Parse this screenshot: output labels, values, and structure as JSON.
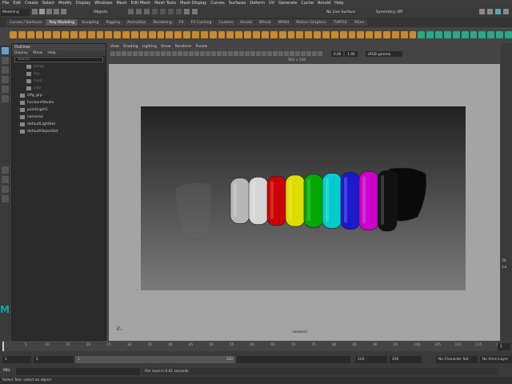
{
  "menubar": [
    "File",
    "Edit",
    "Create",
    "Select",
    "Modify",
    "Display",
    "Windows",
    "Mesh",
    "Edit Mesh",
    "Mesh Tools",
    "Mesh Display",
    "Curves",
    "Surfaces",
    "Deform",
    "UV",
    "Generate",
    "Cache",
    "Arnold",
    "Help"
  ],
  "status": {
    "mode": "Modeling",
    "select_mode": "Objects",
    "live_surface": "No Live Surface",
    "symmetry": "Symmetry: Off"
  },
  "shelf_tabs": [
    "Curves / Surfaces",
    "Poly Modeling",
    "Sculpting",
    "Rigging",
    "Animation",
    "Rendering",
    "FX",
    "FX Caching",
    "Custom",
    "Arnold",
    "Bifrost",
    "MASH",
    "Motion Graphics",
    "TURTLE",
    "XGen"
  ],
  "outliner": {
    "title": "Outliner",
    "menu": [
      "Display",
      "Show",
      "Help"
    ],
    "search_placeholder": "Search...",
    "items": [
      {
        "label": "persp",
        "dim": true
      },
      {
        "label": "top",
        "dim": true
      },
      {
        "label": "front",
        "dim": true
      },
      {
        "label": "side",
        "dim": true
      },
      {
        "label": "stfg_grp",
        "dim": false
      },
      {
        "label": "horizontStudio",
        "dim": false
      },
      {
        "label": "pointLight1",
        "dim": false
      },
      {
        "label": "camera1",
        "dim": false
      },
      {
        "label": "defaultLightSet",
        "dim": false
      },
      {
        "label": "defaultObjectSet",
        "dim": false
      }
    ]
  },
  "viewport": {
    "menu": [
      "View",
      "Shading",
      "Lighting",
      "Show",
      "Renderer",
      "Panels"
    ],
    "resolution": "960 x 540",
    "near_value": "0.00",
    "far_value": "1.00",
    "color_space": "sRGB gamma",
    "camera_label": "camera1"
  },
  "right_panel": [
    "Di",
    "La"
  ],
  "timeline_ticks": [
    "5",
    "10",
    "15",
    "20",
    "25",
    "30",
    "35",
    "40",
    "45",
    "50",
    "55",
    "60",
    "65",
    "70",
    "75",
    "80",
    "85",
    "90",
    "95",
    "100",
    "105",
    "110",
    "115",
    "120"
  ],
  "range": {
    "start": "1",
    "playback_start": "1",
    "current": "1",
    "playback_end": "120",
    "end_a": "120",
    "end_b": "200",
    "character_set": "No Character Set",
    "anim_layer": "No Anim Layer"
  },
  "command": {
    "label": "MEL",
    "message": "File read in  0.61 seconds."
  },
  "help_line": "Select Tool: select an object",
  "rings": [
    {
      "color": "#b8b8b8"
    },
    {
      "color": "#d6d6d6"
    },
    {
      "color": "#cc0000"
    },
    {
      "color": "#dddd00"
    },
    {
      "color": "#00aa00"
    },
    {
      "color": "#00cccc"
    },
    {
      "color": "#1a1acc"
    },
    {
      "color": "#cc00cc"
    },
    {
      "color": "#111111"
    }
  ]
}
